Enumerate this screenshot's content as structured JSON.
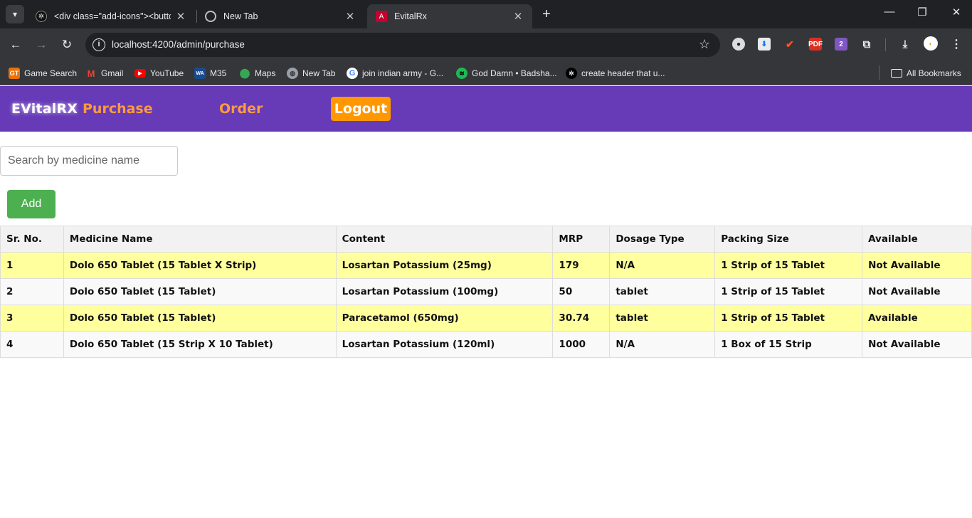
{
  "browser": {
    "tabs": [
      {
        "title": "<div class=\"add-icons\"><button",
        "favicon": "openai-icon",
        "active": false
      },
      {
        "title": "New Tab",
        "favicon": "chrome-icon",
        "active": false
      },
      {
        "title": "EvitalRx",
        "favicon": "angular-icon",
        "active": true
      }
    ],
    "address": "localhost:4200/admin/purchase",
    "bookmarks": [
      {
        "label": "Game Search",
        "icon": "game-search-icon",
        "color": "#e8710a"
      },
      {
        "label": "Gmail",
        "icon": "gmail-icon",
        "color": "#ea4335"
      },
      {
        "label": "YouTube",
        "icon": "youtube-icon",
        "color": "#ff0000"
      },
      {
        "label": "M35",
        "icon": "wa-icon",
        "color": "#1a4b8c"
      },
      {
        "label": "Maps",
        "icon": "maps-icon",
        "color": "#34a853"
      },
      {
        "label": "New Tab",
        "icon": "globe-icon",
        "color": "#9aa0a6"
      },
      {
        "label": "join indian army - G...",
        "icon": "google-icon",
        "color": "#4285f4"
      },
      {
        "label": "God Damn • Badsha...",
        "icon": "spotify-icon",
        "color": "#1db954"
      },
      {
        "label": "create header that u...",
        "icon": "openai-icon",
        "color": "#000000"
      }
    ],
    "all_bookmarks": "All Bookmarks"
  },
  "header": {
    "brand": "EVitalRX",
    "nav": [
      "Purchase",
      "Order"
    ],
    "logout": "Logout",
    "colors": {
      "bar": "#673ab7",
      "link": "#ff9b3d",
      "logout": "#ff9800"
    }
  },
  "search": {
    "placeholder": "Search by medicine name",
    "value": ""
  },
  "add_button": "Add",
  "table": {
    "columns": [
      "Sr. No.",
      "Medicine Name",
      "Content",
      "MRP",
      "Dosage Type",
      "Packing Size",
      "Available"
    ],
    "rows": [
      [
        "1",
        "Dolo 650 Tablet (15 Tablet X Strip)",
        "Losartan Potassium (25mg)",
        "179",
        "N/A",
        "1 Strip of 15 Tablet",
        "Not Available"
      ],
      [
        "2",
        "Dolo 650 Tablet (15 Tablet)",
        "Losartan Potassium (100mg)",
        "50",
        "tablet",
        "1 Strip of 15 Tablet",
        "Not Available"
      ],
      [
        "3",
        "Dolo 650 Tablet (15 Tablet)",
        "Paracetamol (650mg)",
        "30.74",
        "tablet",
        "1 Strip of 15 Tablet",
        "Available"
      ],
      [
        "4",
        "Dolo 650 Tablet (15 Strip X 10 Tablet)",
        "Losartan Potassium (120ml)",
        "1000",
        "N/A",
        "1 Box of 15 Strip",
        "Not Available"
      ]
    ]
  }
}
